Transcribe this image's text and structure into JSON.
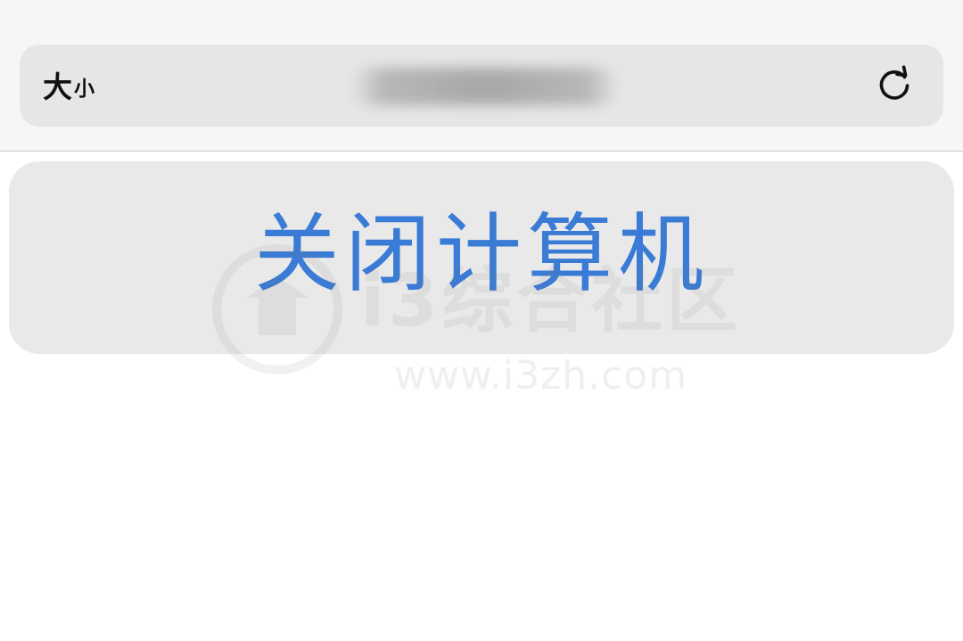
{
  "toolbar": {
    "text_size_big": "大",
    "text_size_small": "小",
    "reload_icon": "reload-icon",
    "url_obscured": true
  },
  "command": {
    "label": "关闭计算机",
    "color": "#3a7bd5"
  },
  "watermark": {
    "name": "i3综合社区",
    "url": "www.i3zh.com"
  }
}
